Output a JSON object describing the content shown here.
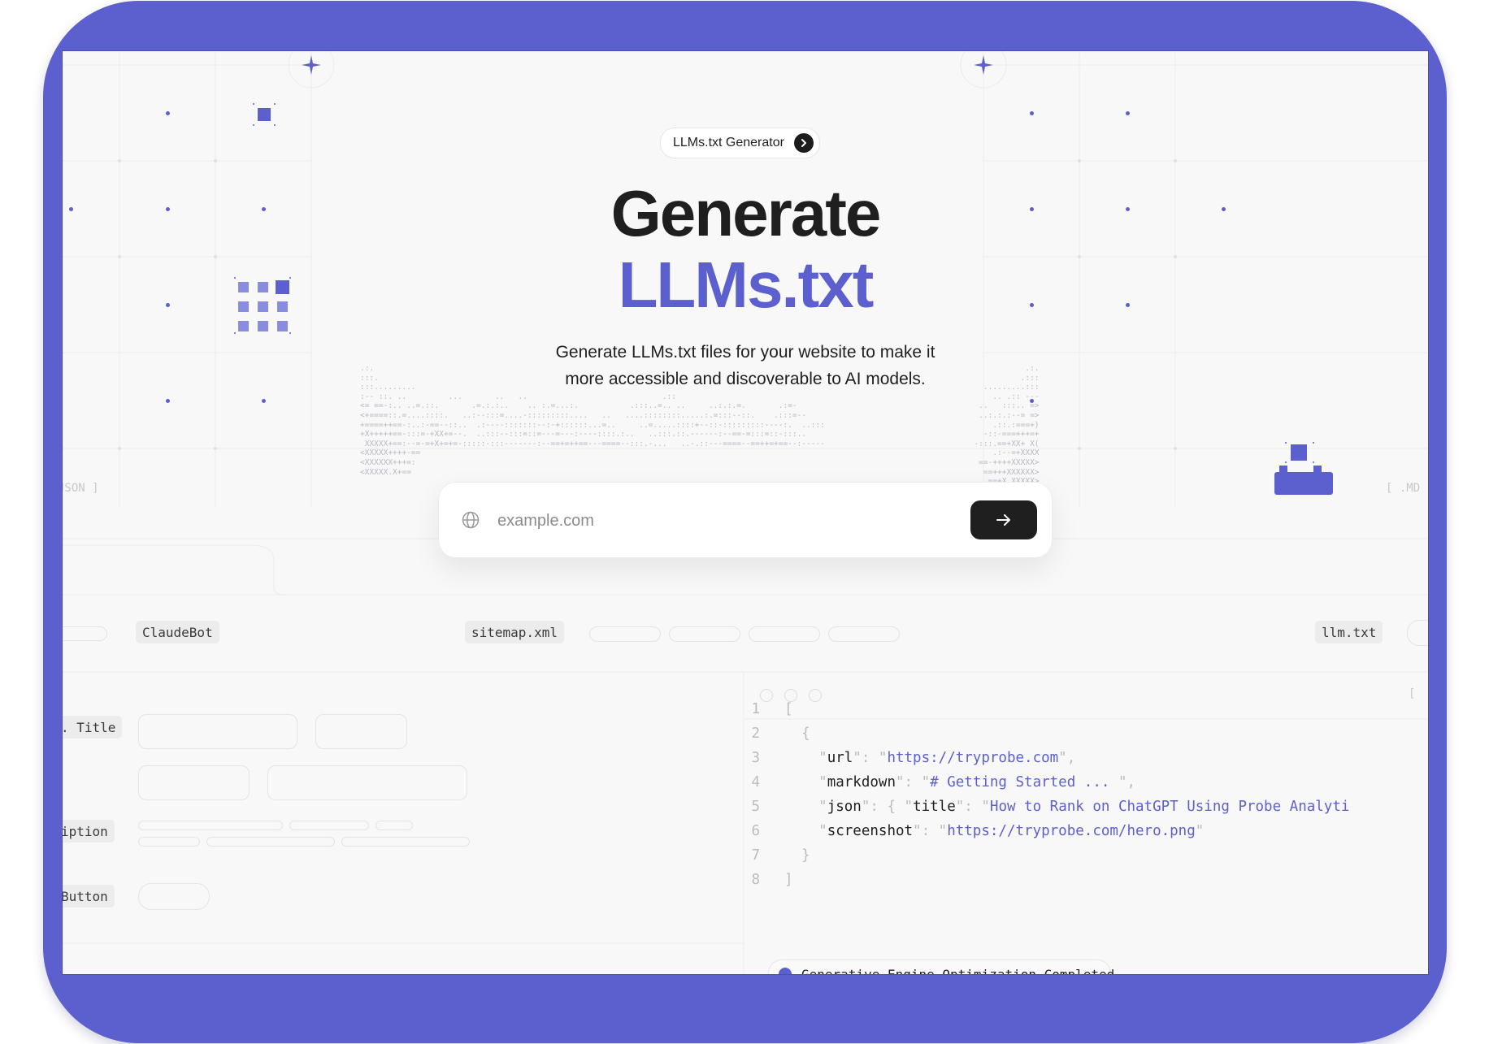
{
  "badge": {
    "label": "LLMs.txt Generator"
  },
  "hero": {
    "headline_line1": "Generate",
    "headline_line2": "LLMs.txt",
    "subtitle_line1": "Generate LLMs.txt files for your website to make it",
    "subtitle_line2": "more accessible and discoverable to AI models."
  },
  "search": {
    "placeholder": "example.com",
    "value": ""
  },
  "side_labels": {
    "left": "JSON ]",
    "right": "[ .MD"
  },
  "chips": {
    "claudebot": "ClaudeBot",
    "sitemap": "sitemap.xml",
    "llm": "llm.txt"
  },
  "form_labels": {
    "title": ". Title",
    "description": "iption",
    "button": "Button"
  },
  "code": {
    "lines": [
      {
        "n": "1",
        "parts": [
          {
            "t": "[",
            "c": "punc"
          }
        ]
      },
      {
        "n": "2",
        "parts": [
          {
            "t": "  {",
            "c": "punc"
          }
        ]
      },
      {
        "n": "3",
        "parts": [
          {
            "t": "    \"",
            "c": "punc"
          },
          {
            "t": "url",
            "c": "key"
          },
          {
            "t": "\": \"",
            "c": "punc"
          },
          {
            "t": "https://tryprobe.com",
            "c": "str"
          },
          {
            "t": "\",",
            "c": "punc"
          }
        ]
      },
      {
        "n": "4",
        "parts": [
          {
            "t": "    \"",
            "c": "punc"
          },
          {
            "t": "markdown",
            "c": "key"
          },
          {
            "t": "\": \"",
            "c": "punc"
          },
          {
            "t": "# Getting Started ...",
            "c": "str"
          },
          {
            "t": " \",",
            "c": "punc"
          }
        ]
      },
      {
        "n": "5",
        "parts": [
          {
            "t": "    \"",
            "c": "punc"
          },
          {
            "t": "json",
            "c": "key"
          },
          {
            "t": "\": { \"",
            "c": "punc"
          },
          {
            "t": "title",
            "c": "key"
          },
          {
            "t": "\": \"",
            "c": "punc"
          },
          {
            "t": "How to Rank on ChatGPT Using Probe Analyti",
            "c": "str"
          }
        ]
      },
      {
        "n": "6",
        "parts": [
          {
            "t": "    \"",
            "c": "punc"
          },
          {
            "t": "screenshot",
            "c": "key"
          },
          {
            "t": "\": \"",
            "c": "punc"
          },
          {
            "t": "https://tryprobe.com/hero.png",
            "c": "str"
          },
          {
            "t": "\"",
            "c": "punc"
          }
        ]
      },
      {
        "n": "7",
        "parts": [
          {
            "t": "  }",
            "c": "punc"
          }
        ]
      },
      {
        "n": "8",
        "parts": [
          {
            "t": "]",
            "c": "punc"
          }
        ]
      }
    ]
  },
  "status": {
    "text": "Generative Engine Optimization Completed"
  },
  "icons": {
    "badge_arrow": "chevron-right-icon",
    "search": "globe-icon",
    "submit": "arrow-right-icon",
    "sparkle": "sparkle-icon"
  },
  "colors": {
    "accent": "#5c5fce",
    "dark": "#1f1f1f",
    "frame": "#5c5fce"
  }
}
